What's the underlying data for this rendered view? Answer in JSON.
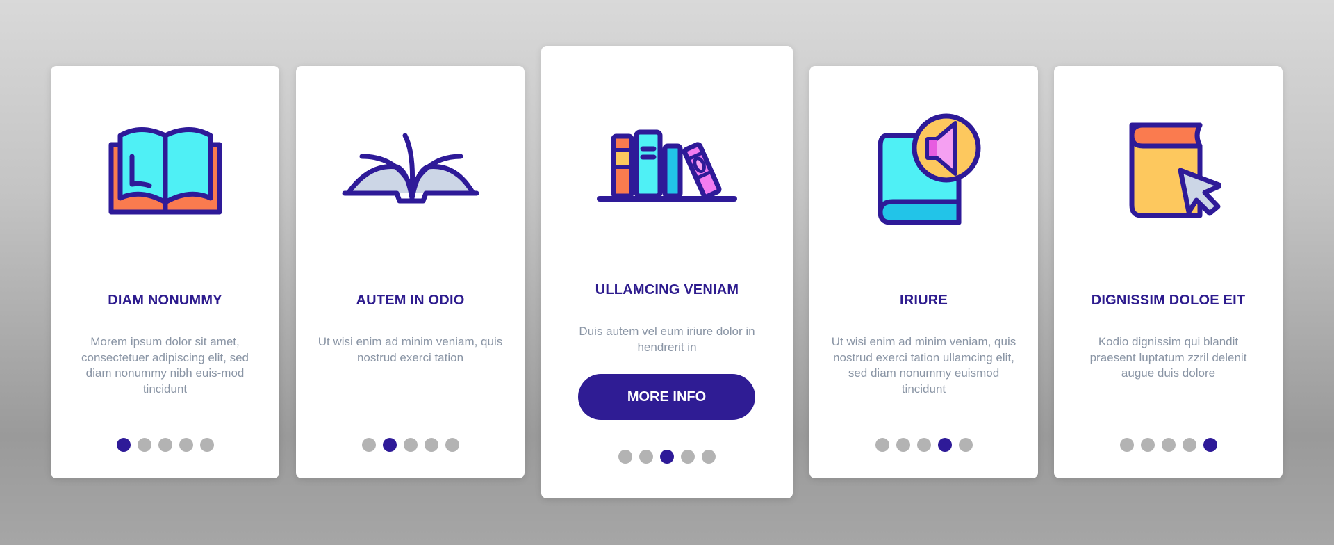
{
  "colors": {
    "primary": "#2e1a98",
    "title_text": "#2d1b8e",
    "body_text": "#8a95a5",
    "dot_inactive": "#b3b3b3",
    "card_bg": "#ffffff",
    "icon_cyan": "#4ff0f5",
    "icon_orange": "#fa7b4f",
    "icon_yellow": "#fdc85e",
    "icon_pink": "#f27cf0",
    "icon_blue": "#22c4e8",
    "icon_gray": "#ccd6e6"
  },
  "pages": [
    {
      "icon": "open-book-icon",
      "title": "DIAM NONUMMY",
      "description": "Morem ipsum dolor sit amet, consectetuer adipiscing elit, sed diam nonummy nibh euis-mod tincidunt",
      "active_dot": 0
    },
    {
      "icon": "flipping-pages-book-icon",
      "title": "AUTEM IN ODIO",
      "description": "Ut wisi enim ad minim veniam, quis nostrud exerci tation",
      "active_dot": 1
    },
    {
      "icon": "bookshelf-icon",
      "title": "ULLAMCING VENIAM",
      "description": "Duis autem vel eum iriure dolor in hendrerit in",
      "button_label": "MORE INFO",
      "active_dot": 2
    },
    {
      "icon": "audiobook-icon",
      "title": "IRIURE",
      "description": "Ut wisi enim ad minim veniam, quis nostrud exerci tation ullamcing elit, sed diam nonummy euismod tincidunt",
      "active_dot": 3
    },
    {
      "icon": "ebook-cursor-icon",
      "title": "DIGNISSIM DOLOE EIT",
      "description": "Kodio dignissim qui blandit praesent luptatum zzril delenit augue duis dolore",
      "active_dot": 4
    }
  ],
  "pagination": {
    "total": 5
  }
}
